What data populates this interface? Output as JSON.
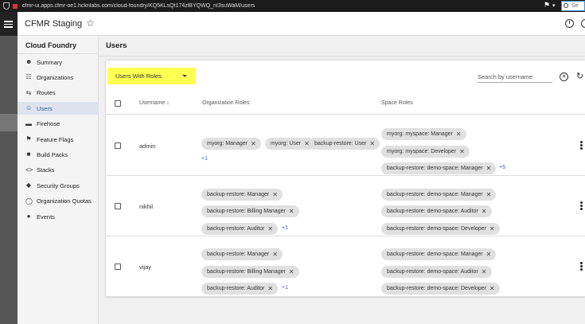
{
  "browser": {
    "url": "cfmr-ui.apps.cfmr-oe1.hcknlabs.com/cloud-foundry/KQ5KLsQt174zlBYQWQ_nI3suWaM/users",
    "search_placeholder": "Se"
  },
  "app": {
    "title": "CFMR Staging"
  },
  "sidebar": {
    "title": "Cloud Foundry",
    "items": [
      {
        "label": "Summary",
        "icon": "person-badge-icon",
        "glyph": "☻"
      },
      {
        "label": "Organizations",
        "icon": "organization-icon",
        "glyph": "☷"
      },
      {
        "label": "Routes",
        "icon": "routes-icon",
        "glyph": "⇆"
      },
      {
        "label": "Users",
        "icon": "users-icon",
        "glyph": "☺"
      },
      {
        "label": "Firehose",
        "icon": "firehose-icon",
        "glyph": "▬"
      },
      {
        "label": "Feature Flags",
        "icon": "flag-icon",
        "glyph": "⚑"
      },
      {
        "label": "Build Packs",
        "icon": "build-packs-icon",
        "glyph": "■"
      },
      {
        "label": "Stacks",
        "icon": "code-icon",
        "glyph": "<>"
      },
      {
        "label": "Security Groups",
        "icon": "security-shield-icon",
        "glyph": "◆"
      },
      {
        "label": "Organization Quotas",
        "icon": "quota-icon",
        "glyph": "◯"
      },
      {
        "label": "Events",
        "icon": "events-icon",
        "glyph": "●"
      }
    ],
    "active": "Users"
  },
  "main": {
    "title": "Users",
    "filter_label": "Users With Roles",
    "search_placeholder": "Search by username",
    "columns": {
      "username": "Username",
      "sort_indicator": "↓",
      "org_roles": "Organization Roles",
      "space_roles": "Space Roles"
    }
  },
  "users": [
    {
      "username": "admin",
      "org_roles": [
        "myorg: Manager",
        "myorg: User",
        "backup-restore: User"
      ],
      "org_more": "+1",
      "space_roles": [
        "myorg: myspace: Manager",
        "myorg: myspace: Developer",
        "backup-restore: demo-space: Manager"
      ],
      "space_more": "+5"
    },
    {
      "username": "nikhil",
      "org_roles": [
        "backup-restore: Manager",
        "backup-restore: Billing Manager",
        "backup-restore: Auditor"
      ],
      "org_more": "+1",
      "space_roles": [
        "backup-restore: demo-space: Manager",
        "backup-restore: demo-space: Auditor",
        "backup-restore: demo-space: Developer"
      ],
      "space_more": ""
    },
    {
      "username": "vijay",
      "org_roles": [
        "backup-restore: Manager",
        "backup-restore: Billing Manager",
        "backup-restore: Auditor"
      ],
      "org_more": "+1",
      "space_roles": [
        "backup-restore: demo-space: Manager",
        "backup-restore: demo-space: Auditor",
        "backup-restore: demo-space: Developer"
      ],
      "space_more": ""
    }
  ],
  "colors": {
    "filter_highlight": "#ffff54",
    "active_nav": "#dde3ec",
    "link": "#3a5fcd"
  }
}
